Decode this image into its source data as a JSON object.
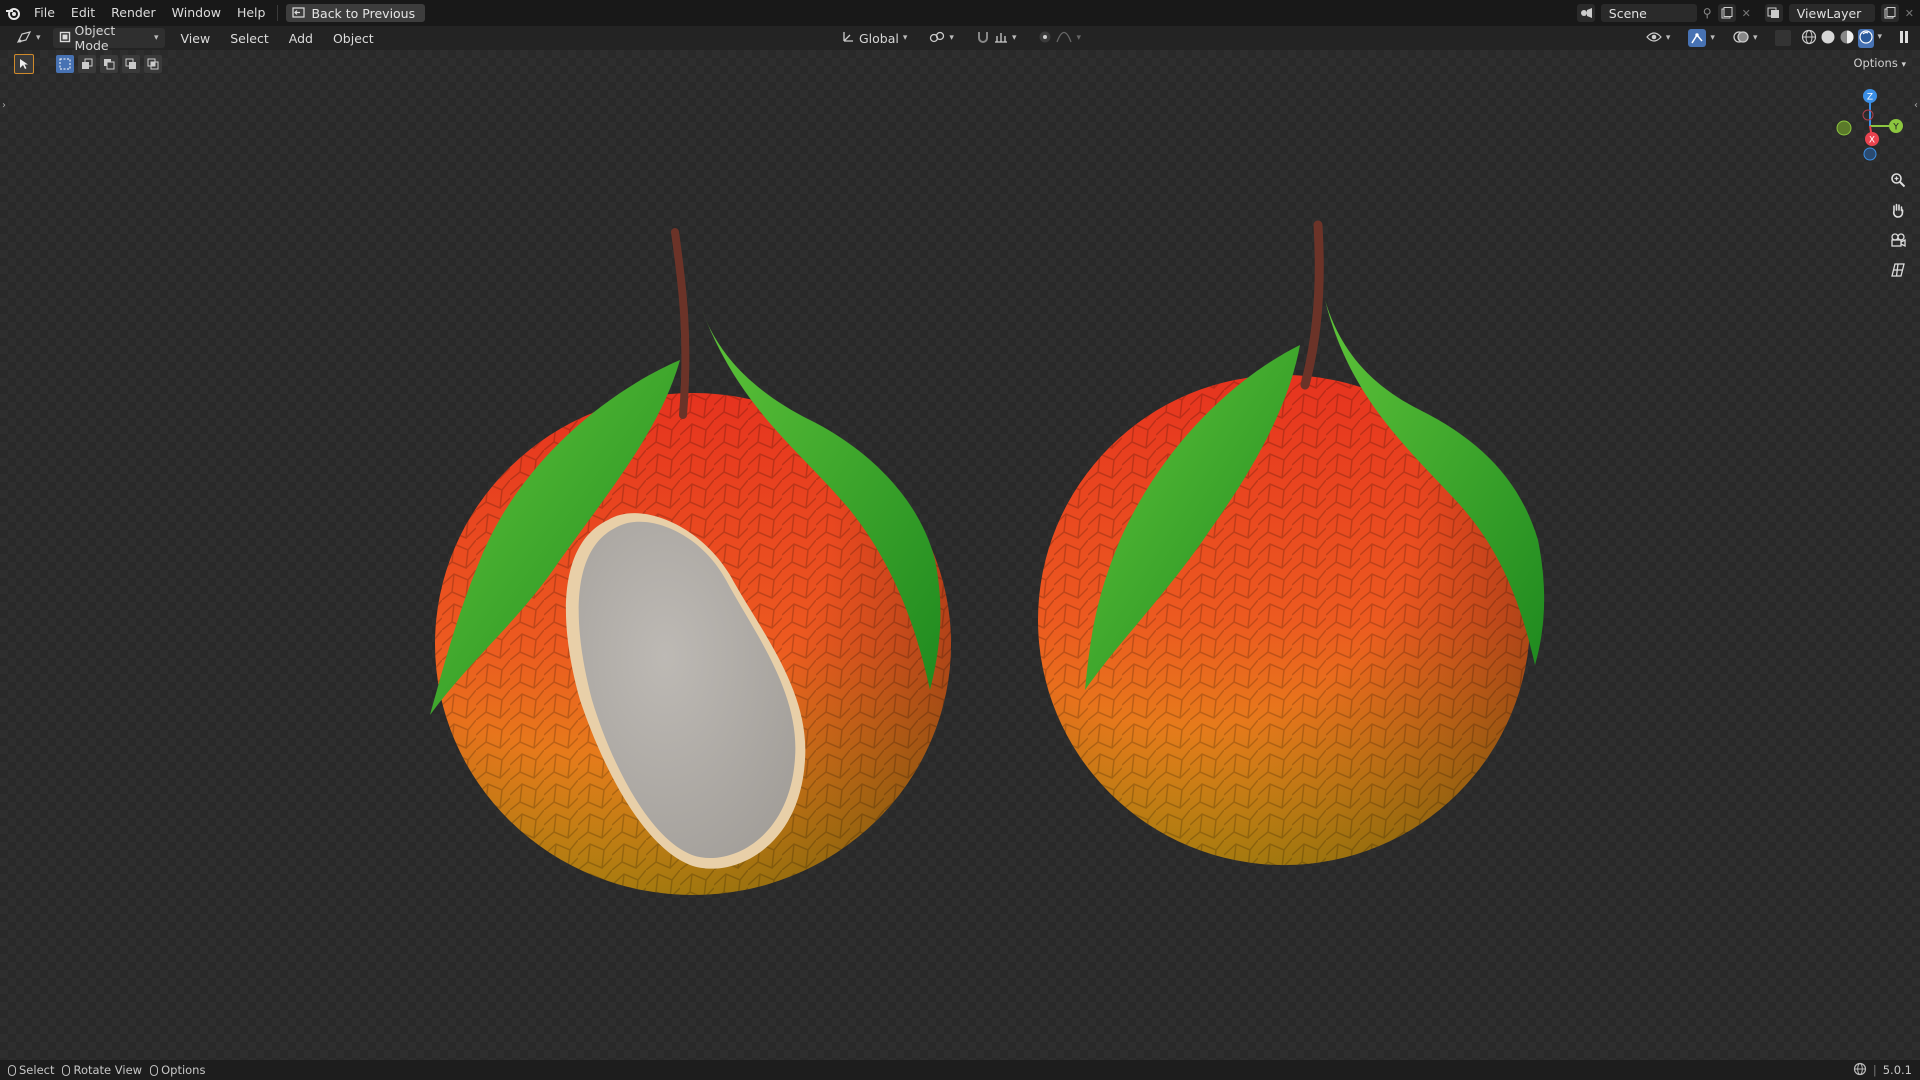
{
  "topbar": {
    "menus": [
      "File",
      "Edit",
      "Render",
      "Window",
      "Help"
    ],
    "back_button": "Back to Previous",
    "scene_name": "Scene",
    "view_layer": "ViewLayer"
  },
  "header": {
    "mode": "Object Mode",
    "menus": [
      "View",
      "Select",
      "Add",
      "Object"
    ],
    "transform_orientation": "Global"
  },
  "viewport": {
    "options_label": "Options",
    "gizmo_axes": {
      "z": "Z",
      "y": "Y",
      "x": "X"
    }
  },
  "statusbar": {
    "select": "Select",
    "rotate_view": "Rotate View",
    "options": "Options",
    "version": "5.0.1"
  },
  "colors": {
    "accent": "#4772b3",
    "axis_x": "#e8434f",
    "axis_y": "#8cc63f",
    "axis_z": "#3b8fe6"
  }
}
